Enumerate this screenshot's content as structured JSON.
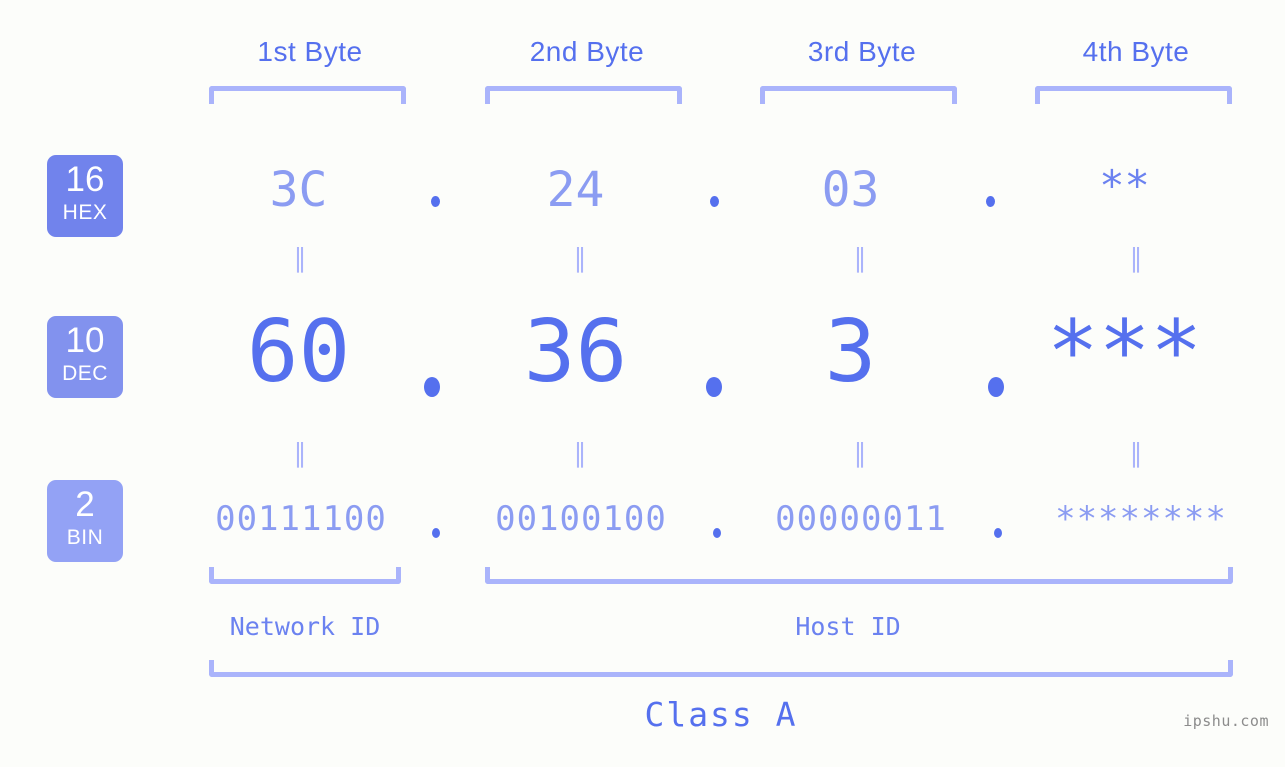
{
  "colors": {
    "background": "#fcfdfa",
    "accent_strong": "#5570ee",
    "accent_mid": "#6b82f0",
    "accent_light": "#8b9cf2",
    "bracket": "#aab4fb",
    "badge_hex": "#7183ec",
    "badge_dec": "#8292ee",
    "badge_bin": "#93a2f5",
    "watermark": "#8c8c8c"
  },
  "headers": [
    {
      "label": "1st Byte"
    },
    {
      "label": "2nd Byte"
    },
    {
      "label": "3rd Byte"
    },
    {
      "label": "4th Byte"
    }
  ],
  "badges": [
    {
      "num": "16",
      "label": "HEX",
      "color": "#7183ec"
    },
    {
      "num": "10",
      "label": "DEC",
      "color": "#8292ee"
    },
    {
      "num": "2",
      "label": "BIN",
      "color": "#93a2f5"
    }
  ],
  "rows": {
    "hex": {
      "radix": "16",
      "name": "HEX",
      "values": [
        "3C",
        "24",
        "03",
        "**"
      ],
      "separator": "."
    },
    "dec": {
      "radix": "10",
      "name": "DEC",
      "values": [
        "60",
        "36",
        "3",
        "***"
      ],
      "separator": "."
    },
    "bin": {
      "radix": "2",
      "name": "BIN",
      "values": [
        "00111100",
        "00100100",
        "00000011",
        "********"
      ],
      "separator": "."
    }
  },
  "equality_separators": [
    "∥",
    "∥",
    "∥",
    "∥",
    "∥",
    "∥",
    "∥",
    "∥"
  ],
  "segments": {
    "network_id": "Network ID",
    "host_id": "Host ID"
  },
  "class_label": "Class A",
  "watermark": "ipshu.com"
}
